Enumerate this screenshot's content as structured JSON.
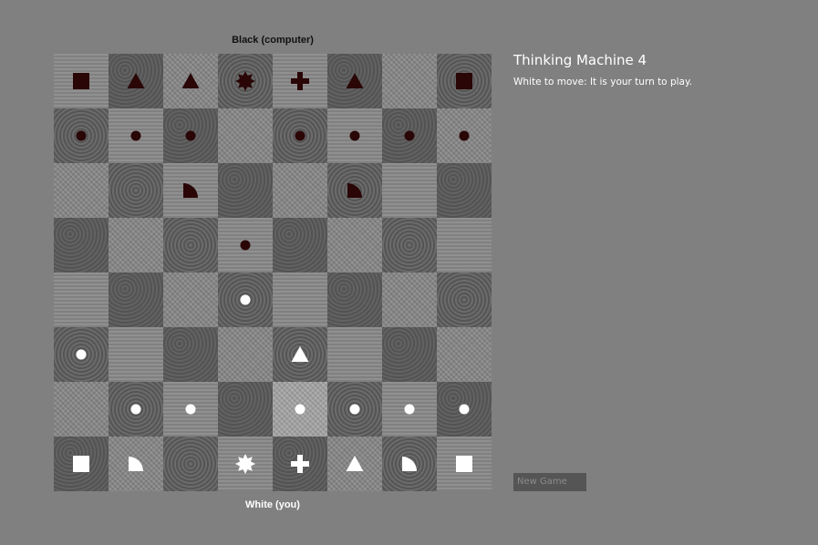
{
  "title": "Thinking Machine 4",
  "status": "White to move: It is your turn to play.",
  "black_label": "Black (computer)",
  "white_label": "White (you)",
  "new_game_label": "New Game",
  "colors": {
    "white_piece": "#ffffff",
    "black_piece": "#2a0606",
    "background": "#808080"
  },
  "board": [
    [
      "black-rook",
      "black-bishop",
      "black-bishop",
      "black-queen",
      "black-king",
      "black-bishop",
      "",
      "black-rook"
    ],
    [
      "black-pawn",
      "black-pawn",
      "black-pawn",
      "",
      "black-pawn",
      "black-pawn",
      "black-pawn",
      "black-pawn"
    ],
    [
      "",
      "",
      "black-knight",
      "",
      "",
      "black-knight",
      "",
      ""
    ],
    [
      "",
      "",
      "",
      "black-pawn",
      "",
      "",
      "",
      ""
    ],
    [
      "",
      "",
      "",
      "white-pawn",
      "",
      "",
      "",
      ""
    ],
    [
      "white-pawn",
      "",
      "",
      "",
      "white-bishop",
      "",
      "",
      ""
    ],
    [
      "",
      "white-pawn",
      "white-pawn",
      "",
      "white-pawn",
      "white-pawn",
      "white-pawn",
      "white-pawn"
    ],
    [
      "white-rook",
      "white-knight",
      "",
      "white-queen",
      "white-king",
      "white-bishop",
      "white-knight",
      "white-rook"
    ]
  ]
}
